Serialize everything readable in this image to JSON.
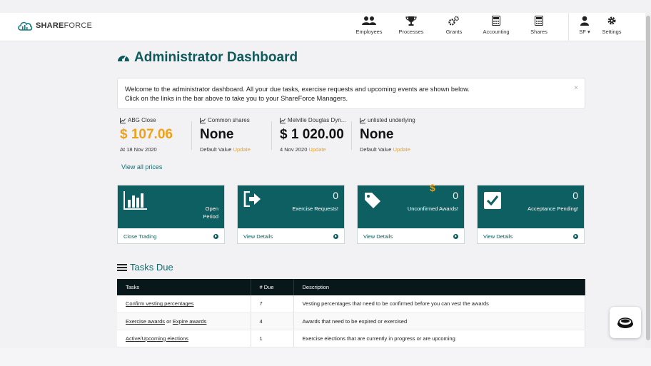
{
  "brand": {
    "name_bold": "SHARE",
    "name_rest": "FORCE"
  },
  "nav": {
    "employees": "Employees",
    "processes": "Processes",
    "grants": "Grants",
    "accounting": "Accounting",
    "shares": "Shares",
    "user": "SF",
    "settings": "Settings"
  },
  "page_title": "Administrator Dashboard",
  "alert": {
    "line1": "Welcome to the administrator dashboard. All your due tasks, exercise requests and upcoming events are shown below.",
    "line2": "Click on the links in the bar above to take you to your ShareForce Managers.",
    "close": "×"
  },
  "prices": [
    {
      "label": "ABG Close",
      "value": "$ 107.06",
      "sub": "At 18 Nov 2020",
      "update": ""
    },
    {
      "label": "Common shares",
      "value": "None",
      "sub": "Default Value",
      "update": "Update"
    },
    {
      "label": "Melville Douglas Dyn...",
      "value": "$ 1 020.00",
      "sub": "4 Nov 2020",
      "update": "Update"
    },
    {
      "label": "unlisted underlying",
      "value": "None",
      "sub": "Default Value",
      "update": "Update"
    }
  ],
  "view_all_prices": "View all prices",
  "cards": [
    {
      "number": "",
      "caption_1": "Open",
      "caption_2": "Period",
      "link": "Close Trading",
      "icon": "bar-chart-icon"
    },
    {
      "number": "0",
      "caption_1": "Exercise Requests!",
      "caption_2": "",
      "link": "View Details",
      "icon": "sign-out-icon"
    },
    {
      "number": "0",
      "caption_1": "Unconfirmed Awards!",
      "caption_2": "",
      "link": "View Details",
      "icon": "tag-icon"
    },
    {
      "number": "0",
      "caption_1": "Acceptance Pending!",
      "caption_2": "",
      "link": "View Details",
      "icon": "check-square-icon"
    }
  ],
  "dollar_marker": "$",
  "tasks": {
    "title": "Tasks Due",
    "headers": [
      "Tasks",
      "# Due",
      "Description"
    ],
    "rows": [
      {
        "task": "Confirm vesting percentages",
        "task_mid": "",
        "task_2": "",
        "due": "7",
        "desc": "Vesting percentages that need to be confirmed before you can vest the awards"
      },
      {
        "task": "Exercise awards",
        "task_mid": " or ",
        "task_2": "Expire awards",
        "due": "4",
        "desc": "Awards that need to be expired or exercised"
      },
      {
        "task": "Active/Upcoming elections",
        "task_mid": "",
        "task_2": "",
        "due": "1",
        "desc": "Exercise elections that are currently in progress or are upcoming"
      }
    ]
  },
  "colors": {
    "teal": "#0e5f62",
    "orange": "#f0a015",
    "table_header": "#08181a"
  }
}
